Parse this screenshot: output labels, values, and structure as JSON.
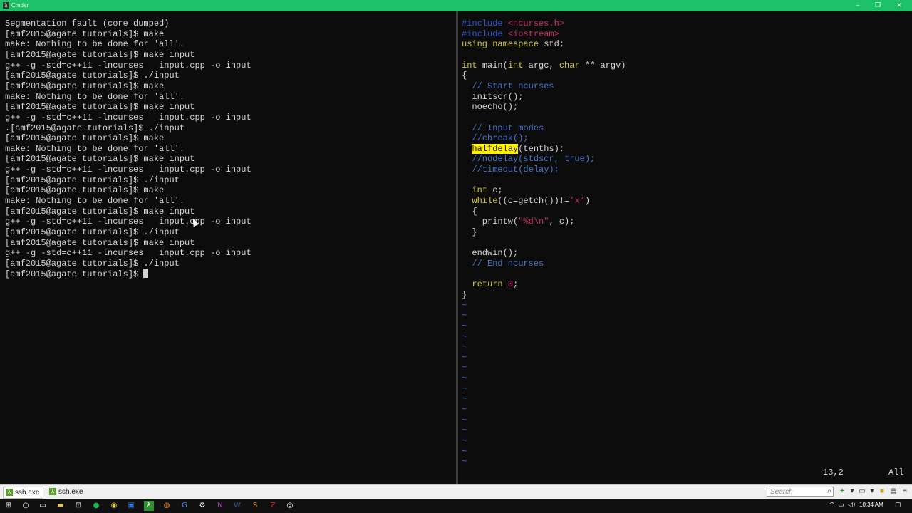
{
  "window": {
    "title": "Cmder",
    "logo_glyph": "λ",
    "controls": {
      "minimize": "–",
      "maximize": "❐",
      "close": "✕"
    }
  },
  "terminal": {
    "lines": [
      "Segmentation fault (core dumped)",
      "[amf2015@agate tutorials]$ make",
      "make: Nothing to be done for 'all'.",
      "[amf2015@agate tutorials]$ make input",
      "g++ -g -std=c++11 -lncurses   input.cpp -o input",
      "[amf2015@agate tutorials]$ ./input",
      "[amf2015@agate tutorials]$ make",
      "make: Nothing to be done for 'all'.",
      "[amf2015@agate tutorials]$ make input",
      "g++ -g -std=c++11 -lncurses   input.cpp -o input",
      ".[amf2015@agate tutorials]$ ./input",
      "[amf2015@agate tutorials]$ make",
      "make: Nothing to be done for 'all'.",
      "[amf2015@agate tutorials]$ make input",
      "g++ -g -std=c++11 -lncurses   input.cpp -o input",
      "[amf2015@agate tutorials]$ ./input",
      "[amf2015@agate tutorials]$ make",
      "make: Nothing to be done for 'all'.",
      "[amf2015@agate tutorials]$ make input",
      "g++ -g -std=c++11 -lncurses   input.cpp -o input",
      "[amf2015@agate tutorials]$ ./input",
      "[amf2015@agate tutorials]$ make input",
      "g++ -g -std=c++11 -lncurses   input.cpp -o input",
      "[amf2015@agate tutorials]$ ./input",
      "[amf2015@agate tutorials]$ "
    ]
  },
  "editor": {
    "code": [
      [
        [
          "#include ",
          "pp"
        ],
        [
          "<ncurses.h>",
          "str"
        ]
      ],
      [
        [
          "#include ",
          "pp"
        ],
        [
          "<iostream>",
          "str"
        ]
      ],
      [
        [
          "using ",
          "kw"
        ],
        [
          "namespace ",
          "kw"
        ],
        [
          "std;",
          ""
        ]
      ],
      [],
      [
        [
          "int ",
          "kw"
        ],
        [
          "main(",
          ""
        ],
        [
          "int ",
          "kw"
        ],
        [
          "argc, ",
          ""
        ],
        [
          "char ",
          "kw"
        ],
        [
          "** argv)",
          ""
        ]
      ],
      [
        [
          "{",
          ""
        ]
      ],
      [
        [
          "  // Start ncurses",
          "cm"
        ]
      ],
      [
        [
          "  initscr();",
          ""
        ]
      ],
      [
        [
          "  noecho();",
          ""
        ]
      ],
      [],
      [
        [
          "  // Input modes",
          "cm"
        ]
      ],
      [
        [
          "  //cbreak();",
          "cm"
        ]
      ],
      [
        [
          "  ",
          ""
        ],
        [
          "halfdelay",
          "hl"
        ],
        [
          "(tenths);",
          ""
        ]
      ],
      [
        [
          "  //nodelay(stdscr, true);",
          "cm"
        ]
      ],
      [
        [
          "  //timeout(delay);",
          "cm"
        ]
      ],
      [],
      [
        [
          "  ",
          ""
        ],
        [
          "int ",
          "kw"
        ],
        [
          "c;",
          ""
        ]
      ],
      [
        [
          "  ",
          ""
        ],
        [
          "while",
          "kw"
        ],
        [
          "((c=getch())!=",
          ""
        ],
        [
          "'x'",
          "str"
        ],
        [
          ")",
          ""
        ]
      ],
      [
        [
          "  {",
          ""
        ]
      ],
      [
        [
          "    printw(",
          ""
        ],
        [
          "\"%d\\n\"",
          "str"
        ],
        [
          ", c);",
          ""
        ]
      ],
      [
        [
          "  }",
          ""
        ]
      ],
      [],
      [
        [
          "  endwin();",
          ""
        ]
      ],
      [
        [
          "  // End ncurses",
          "cm"
        ]
      ],
      [],
      [
        [
          "  ",
          ""
        ],
        [
          "return ",
          "kw"
        ],
        [
          "0",
          "num"
        ],
        [
          ";",
          ""
        ]
      ],
      [
        [
          "}",
          ""
        ]
      ]
    ],
    "tilde_count": 16,
    "tilde_glyph": "~",
    "status_position": "13,2",
    "status_scope": "All"
  },
  "tabs": [
    {
      "label": "ssh.exe",
      "active": true
    },
    {
      "label": "ssh.exe",
      "active": false
    }
  ],
  "search": {
    "placeholder": "Search"
  },
  "taskbar": {
    "clock": "10:34 AM",
    "icons": [
      "windows-start-icon",
      "cortana-icon",
      "task-view-icon",
      "file-explorer-icon",
      "store-icon",
      "spotify-icon",
      "chrome-icon",
      "outlook-icon",
      "cmder-icon",
      "firefox-icon",
      "google-icon",
      "settings-icon",
      "onenote-icon",
      "word-icon",
      "sublime-icon",
      "filezilla-icon",
      "github-icon"
    ]
  },
  "colors": {
    "titlebar": "#1dc16a",
    "keyword": "#d1c73a",
    "preprocessor": "#2f57d4",
    "string": "#c72d6b",
    "comment": "#4a76c9",
    "highlight": "#ffee00"
  }
}
